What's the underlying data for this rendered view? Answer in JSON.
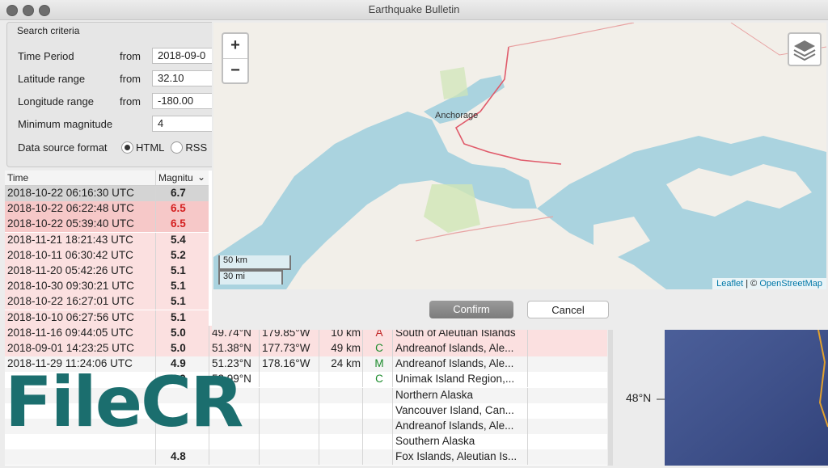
{
  "window": {
    "title": "Earthquake Bulletin"
  },
  "criteria": {
    "legend": "Search criteria",
    "time_label": "Time Period",
    "time_from_label": "from",
    "time_from_value": "2018-09-0",
    "lat_label": "Latitude range",
    "lat_from_label": "from",
    "lat_from_value": "32.10",
    "lon_label": "Longitude range",
    "lon_from_label": "from",
    "lon_from_value": "-180.00",
    "mag_label": "Minimum magnitude",
    "mag_value": "4",
    "format_label": "Data source format",
    "format_html": "HTML",
    "format_rss": "RSS"
  },
  "table": {
    "headers": {
      "time": "Time",
      "magnitude": "Magnitu"
    },
    "rows": [
      {
        "time": "2018-10-22 06:16:30 UTC",
        "mag": "6.7"
      },
      {
        "time": "2018-10-22 06:22:48 UTC",
        "mag": "6.5"
      },
      {
        "time": "2018-10-22 05:39:40 UTC",
        "mag": "6.5"
      },
      {
        "time": "2018-11-21 18:21:43 UTC",
        "mag": "5.4"
      },
      {
        "time": "2018-10-11 06:30:42 UTC",
        "mag": "5.2"
      },
      {
        "time": "2018-11-20 05:42:26 UTC",
        "mag": "5.1"
      },
      {
        "time": "2018-10-30 09:30:21 UTC",
        "mag": "5.1"
      },
      {
        "time": "2018-10-22 16:27:01 UTC",
        "mag": "5.1"
      },
      {
        "time": "2018-10-10 06:27:56 UTC",
        "mag": "5.1"
      },
      {
        "time": "2018-11-16 09:44:05 UTC",
        "mag": "5.0",
        "lat": "49.74°N",
        "lon": "179.85°W",
        "depth": "10 km",
        "grade": "A",
        "region": "South of Aleutian Islands"
      },
      {
        "time": "2018-09-01 14:23:25 UTC",
        "mag": "5.0",
        "lat": "51.38°N",
        "lon": "177.73°W",
        "depth": "49 km",
        "grade": "C",
        "region": "Andreanof Islands, Ale..."
      },
      {
        "time": "2018-11-29 11:24:06 UTC",
        "mag": "4.9",
        "lat": "51.23°N",
        "lon": "178.16°W",
        "depth": "24 km",
        "grade": "M",
        "region": "Andreanof Islands, Ale..."
      },
      {
        "time": "",
        "mag": "4.9",
        "lat": "53.99°N",
        "lon": "",
        "depth": "",
        "grade": "C",
        "region": "Unimak Island Region,..."
      },
      {
        "time": "",
        "mag": "",
        "lat": "",
        "lon": "",
        "depth": "",
        "grade": "",
        "region": "Northern Alaska"
      },
      {
        "time": "",
        "mag": "",
        "lat": "",
        "lon": "",
        "depth": "",
        "grade": "",
        "region": "Vancouver Island, Can..."
      },
      {
        "time": "",
        "mag": "",
        "lat": "",
        "lon": "",
        "depth": "",
        "grade": "",
        "region": "Andreanof Islands, Ale..."
      },
      {
        "time": "",
        "mag": "",
        "lat": "",
        "lon": "",
        "depth": "",
        "grade": "",
        "region": "Southern Alaska"
      },
      {
        "time": "",
        "mag": "4.8",
        "lat": "",
        "lon": "",
        "depth": "",
        "grade": "",
        "region": "Fox Islands, Aleutian Is..."
      }
    ]
  },
  "map": {
    "zoom_in": "+",
    "zoom_out": "−",
    "place_label": "Anchorage",
    "scale_km": "50 km",
    "scale_mi": "30 mi",
    "attribution_leaflet": "Leaflet",
    "attribution_sep": " | © ",
    "attribution_osm": "OpenStreetMap",
    "colors": {
      "water": "#aad3df",
      "land": "#f2efe9",
      "road": "#e05a6a"
    }
  },
  "dialog": {
    "confirm_label": "Confirm",
    "cancel_label": "Cancel"
  },
  "right_map": {
    "lat_label": "48°N"
  },
  "watermark": {
    "text": "FileCR"
  }
}
